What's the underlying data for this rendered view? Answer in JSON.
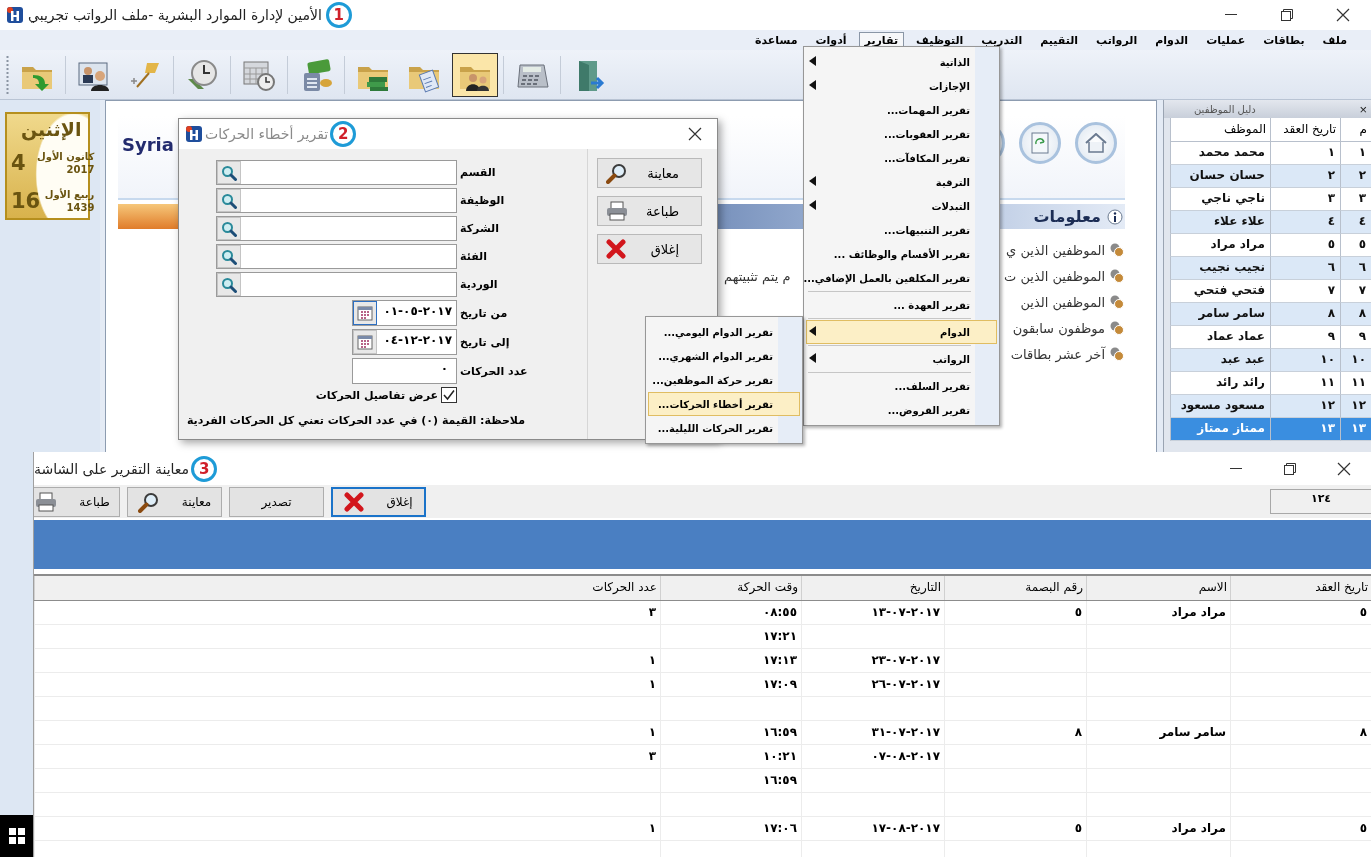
{
  "main_window": {
    "title": "الأمين لإدارة الموارد البشرية -ملف الرواتب تجريبي",
    "badge": "1"
  },
  "menu_bar": [
    {
      "label": "ملف",
      "selected": false
    },
    {
      "label": "بطاقات",
      "selected": false
    },
    {
      "label": "عمليات",
      "selected": false
    },
    {
      "label": "الدوام",
      "selected": false
    },
    {
      "label": "الرواتب",
      "selected": false
    },
    {
      "label": "التقييم",
      "selected": false
    },
    {
      "label": "التدريب",
      "selected": false
    },
    {
      "label": "التوظيف",
      "selected": false
    },
    {
      "label": "تقارير",
      "selected": true
    },
    {
      "label": "أدوات",
      "selected": false
    },
    {
      "label": "مساعدة",
      "selected": false
    }
  ],
  "toolbar": [
    {
      "kind": "folder-arrow",
      "selected": false
    },
    {
      "kind": "person-card",
      "selected": false
    },
    {
      "kind": "pin",
      "selected": false
    },
    {
      "kind": "clock-book",
      "selected": false
    },
    {
      "kind": "calendar-clock",
      "selected": false
    },
    {
      "kind": "money",
      "selected": false
    },
    {
      "kind": "folder-books",
      "selected": false
    },
    {
      "kind": "folder-document",
      "selected": false
    },
    {
      "kind": "folder-people",
      "selected": true
    },
    {
      "kind": "calculator",
      "selected": false
    },
    {
      "kind": "door",
      "selected": false
    }
  ],
  "date_card": {
    "weekday": "الإثنين",
    "day": "4",
    "month": "كانون الأول",
    "year": "2017",
    "hijri_day": "16",
    "hijri_month": "ربيع الأول",
    "hijri_year": "1439"
  },
  "home": {
    "banner": "Syria",
    "info_title": "معلومات",
    "links": [
      {
        "text": "الموظفين الذين ي"
      },
      {
        "text": "الموظفين الذين ت",
        "tail": "م يتم تثبيتهم"
      },
      {
        "text": "الموظفين الذين"
      },
      {
        "text": "موظفون سابقون"
      },
      {
        "text": "آخر عشر بطاقات"
      }
    ]
  },
  "employee_panel": {
    "title": "دليل الموظفين",
    "close": "×",
    "columns": [
      "م",
      "تاريخ العقد",
      "الموظف"
    ],
    "rows": [
      {
        "no": "١",
        "contract": "١",
        "name": "محمد محمد",
        "selected": false
      },
      {
        "no": "٢",
        "contract": "٢",
        "name": "حسان حسان",
        "selected": false
      },
      {
        "no": "٣",
        "contract": "٣",
        "name": "ناجي ناجي",
        "selected": false
      },
      {
        "no": "٤",
        "contract": "٤",
        "name": "علاء علاء",
        "selected": false
      },
      {
        "no": "٥",
        "contract": "٥",
        "name": "مراد مراد",
        "selected": false
      },
      {
        "no": "٦",
        "contract": "٦",
        "name": "نجيب نجيب",
        "selected": false
      },
      {
        "no": "٧",
        "contract": "٧",
        "name": "فتحي فتحي",
        "selected": false
      },
      {
        "no": "٨",
        "contract": "٨",
        "name": "سامر سامر",
        "selected": false
      },
      {
        "no": "٩",
        "contract": "٩",
        "name": "عماد عماد",
        "selected": false
      },
      {
        "no": "١٠",
        "contract": "١٠",
        "name": "عبد عبد",
        "selected": false
      },
      {
        "no": "١١",
        "contract": "١١",
        "name": "رائد رائد",
        "selected": false
      },
      {
        "no": "١٢",
        "contract": "١٢",
        "name": "مسعود مسعود",
        "selected": false
      },
      {
        "no": "١٣",
        "contract": "١٣",
        "name": "ممتاز ممتاز",
        "selected": true
      }
    ]
  },
  "reports_menu": [
    {
      "kind": "submenu",
      "label": "الذاتية",
      "selected": false
    },
    {
      "kind": "submenu",
      "label": "الإجازات",
      "selected": false
    },
    {
      "kind": "item",
      "label": "تقرير المهمات...",
      "selected": false
    },
    {
      "kind": "item",
      "label": "تقرير العقوبات...",
      "selected": false
    },
    {
      "kind": "item",
      "label": "تقرير المكافآت...",
      "selected": false
    },
    {
      "kind": "submenu",
      "label": "الترقية",
      "selected": false
    },
    {
      "kind": "submenu",
      "label": "التبدلات",
      "selected": false
    },
    {
      "kind": "item",
      "label": "تقرير التنبيهات...",
      "selected": false
    },
    {
      "kind": "item",
      "label": "تقرير الأقسام والوظائف ...",
      "selected": false
    },
    {
      "kind": "item",
      "label": "تقرير المكلفين بالعمل الإضافي...",
      "selected": false
    },
    {
      "kind": "separator"
    },
    {
      "kind": "item",
      "label": "تقرير العهدة ...",
      "selected": false
    },
    {
      "kind": "separator"
    },
    {
      "kind": "submenu",
      "label": "الدوام",
      "selected": true
    },
    {
      "kind": "separator"
    },
    {
      "kind": "submenu",
      "label": "الرواتب",
      "selected": false
    },
    {
      "kind": "separator"
    },
    {
      "kind": "item",
      "label": "تقرير السلف...",
      "selected": false
    },
    {
      "kind": "item",
      "label": "تقرير القروض...",
      "selected": false
    }
  ],
  "attendance_submenu": [
    {
      "label": "تقرير الدوام اليومي...",
      "selected": false
    },
    {
      "label": "تقرير الدوام الشهري...",
      "selected": false
    },
    {
      "label": "تقرير حركة الموظفين...",
      "selected": false
    },
    {
      "label": "تقرير أخطاء الحركات...",
      "selected": true
    },
    {
      "label": "تقرير الحركات الليلية...",
      "selected": false
    }
  ],
  "dialog": {
    "title": "تقرير أخطاء الحركات",
    "badge": "2",
    "buttons": [
      {
        "kind": "preview",
        "label": "معاينة"
      },
      {
        "kind": "print",
        "label": "طباعة"
      },
      {
        "kind": "close",
        "label": "إغلاق"
      }
    ],
    "lookups": [
      {
        "label": "القسم"
      },
      {
        "label": "الوظيفة"
      },
      {
        "label": "الشركة"
      },
      {
        "label": "الفئة"
      },
      {
        "label": "الوردية"
      }
    ],
    "from_date": {
      "label": "من تاريخ",
      "value": "٠١-٠٥-٢٠١٧",
      "focused": true
    },
    "to_date": {
      "label": "إلى تاريخ",
      "value": "٠٤-١٢-٢٠١٧",
      "focused": false
    },
    "count": {
      "label": "عدد الحركات",
      "value": "٠"
    },
    "details": {
      "label": "عرض تفاصيل الحركات",
      "checked": true
    },
    "note": "ملاحظة: القيمة (٠) في عدد الحركات تعني كل الحركات الفردية"
  },
  "report_window": {
    "title": "معاينة التقرير على الشاشة",
    "badge": "3",
    "page": "١٢٤",
    "buttons": [
      {
        "kind": "close",
        "label": "إغلاق",
        "focused": true
      },
      {
        "kind": "export",
        "label": "تصدير",
        "focused": false
      },
      {
        "kind": "preview",
        "label": "معاينة",
        "focused": false
      },
      {
        "kind": "print",
        "label": "طباعة",
        "focused": false
      }
    ],
    "columns": [
      "تاريخ العقد",
      "الاسم",
      "رقم البصمة",
      "التاريخ",
      "وقت الحركة",
      "عدد الحركات"
    ],
    "rows": [
      {
        "contract_date": "٥",
        "name": "مراد مراد",
        "fingerprint": "٥",
        "date": "١٣-٠٧-٢٠١٧",
        "time": "٠٨:٥٥",
        "count": "٣"
      },
      {
        "time": "١٧:٢١"
      },
      {
        "date": "٢٣-٠٧-٢٠١٧",
        "time": "١٧:١٣",
        "count": "١"
      },
      {
        "date": "٢٦-٠٧-٢٠١٧",
        "time": "١٧:٠٩",
        "count": "١"
      },
      {},
      {
        "contract_date": "٨",
        "name": "سامر سامر",
        "fingerprint": "٨",
        "date": "٣١-٠٧-٢٠١٧",
        "time": "١٦:٥٩",
        "count": "١"
      },
      {
        "date": "٠٧-٠٨-٢٠١٧",
        "time": "١٠:٢١",
        "count": "٣"
      },
      {
        "time": "١٦:٥٩"
      },
      {},
      {
        "contract_date": "٥",
        "name": "مراد مراد",
        "fingerprint": "٥",
        "date": "١٧-٠٨-٢٠١٧",
        "time": "١٧:٠٦",
        "count": "١"
      },
      {}
    ]
  }
}
